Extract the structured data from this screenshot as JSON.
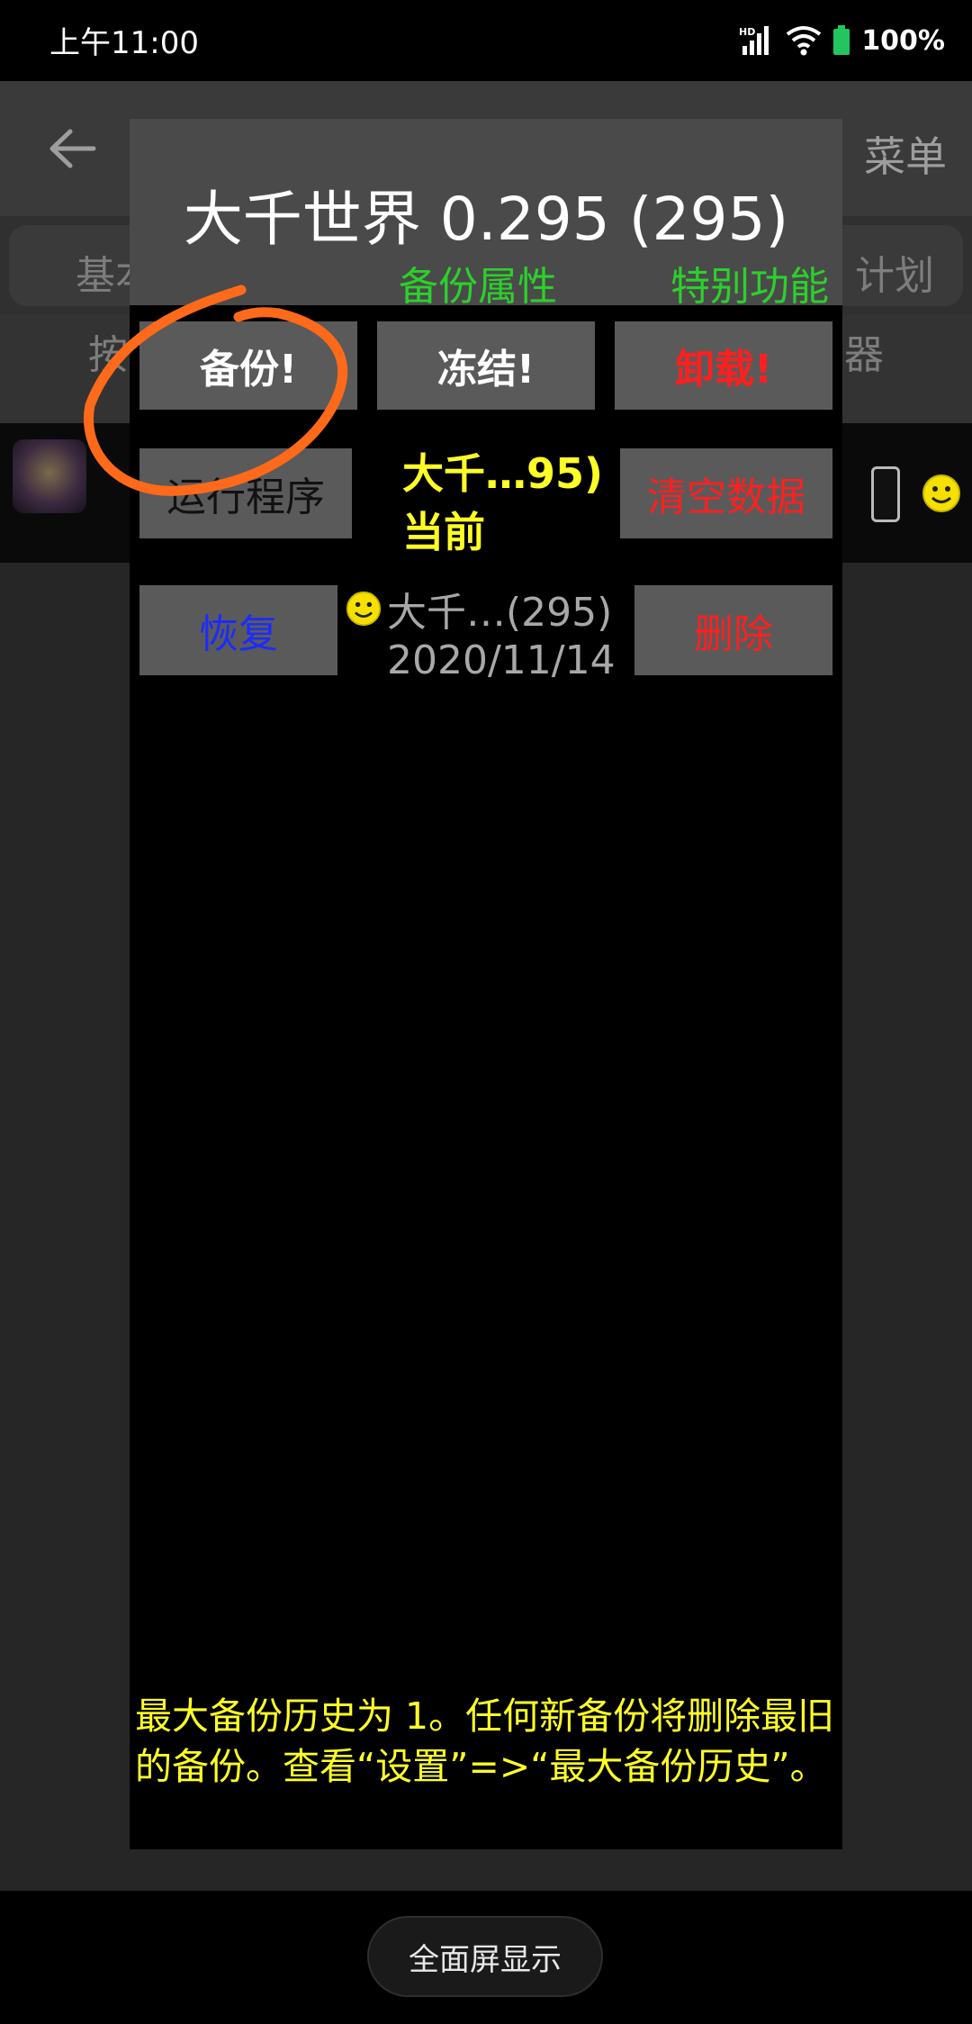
{
  "status_bar": {
    "time": "上午11:00",
    "battery": "100%"
  },
  "background_app": {
    "menu_label": "菜单",
    "tab_left_fragment": "基本",
    "tab_right_fragment": "计划",
    "row2_left_fragment": "按",
    "row2_right_fragment": "器"
  },
  "dialog": {
    "title": "大千世界 0.295 (295)",
    "tabs": {
      "backup_attributes": "备份属性",
      "special_functions": "特别功能"
    },
    "buttons": {
      "backup": "备份!",
      "freeze": "冻结!",
      "uninstall": "卸载!",
      "run_program": "运行程序",
      "clear_data": "清空数据",
      "restore": "恢复",
      "delete": "删除"
    },
    "current": {
      "name": "大千…95)",
      "state": "当前"
    },
    "history_item": {
      "name": "大千…(295)",
      "date": "2020/11/14"
    },
    "footer_note": "最大备份历史为 1。任何新备份将删除最旧的备份。查看“设置”=>“最大备份历史”。"
  },
  "nav_bar": {
    "fullscreen_label": "全面屏显示"
  },
  "colors": {
    "title_white": "#ffffff",
    "tab_green": "#2bd12b",
    "current_yellow": "#ffff26",
    "danger_red": "#ff1f1f",
    "restore_blue": "#1b2bff",
    "annotation_orange": "#ff6a1a"
  }
}
